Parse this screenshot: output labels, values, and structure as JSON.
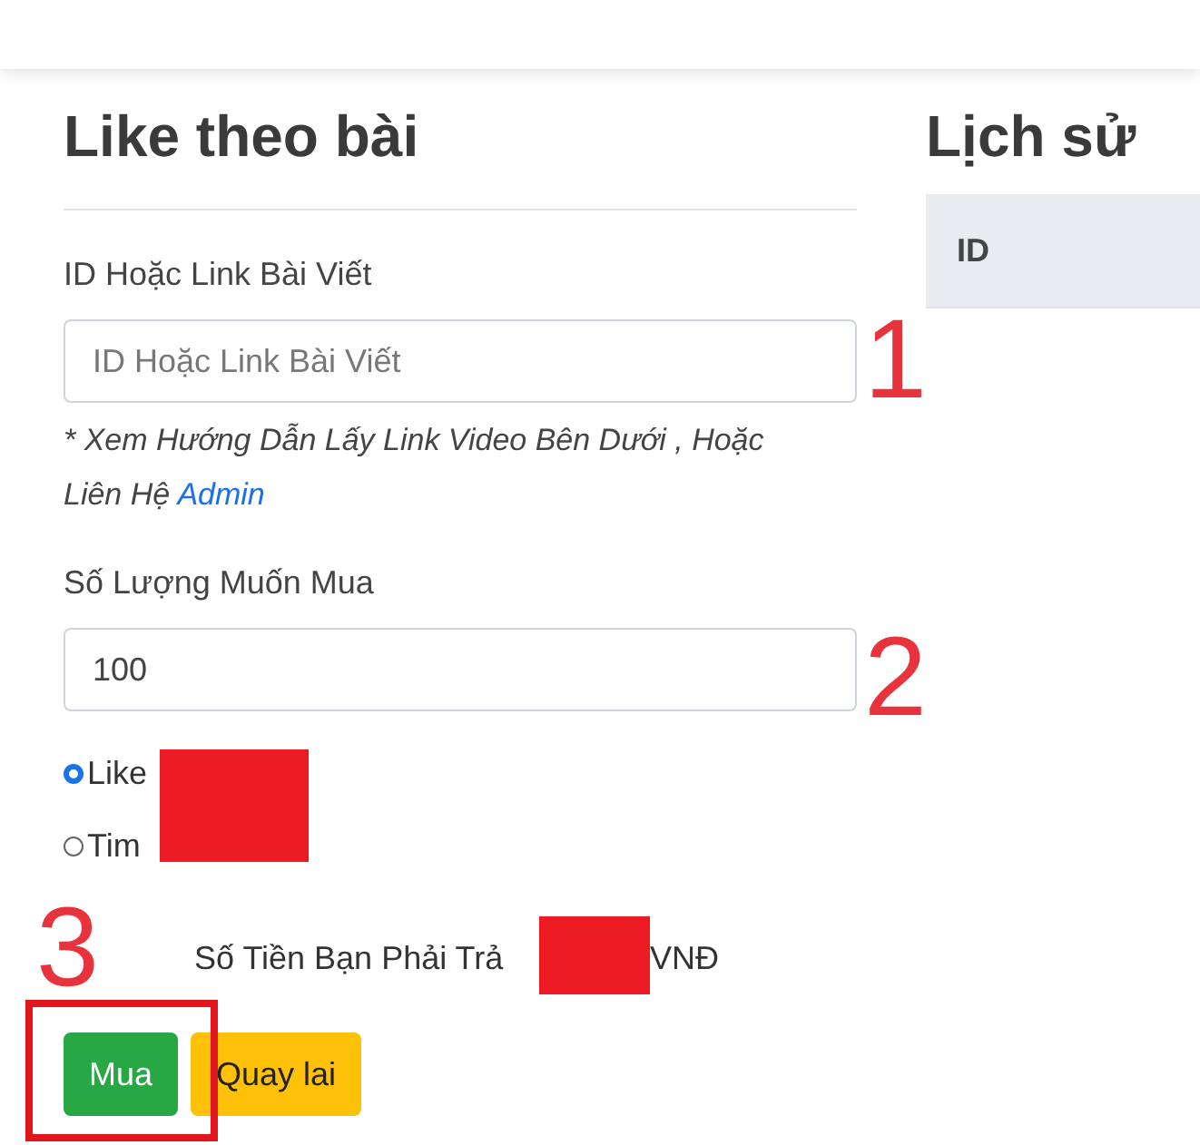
{
  "form": {
    "title": "Like theo bài",
    "link_field": {
      "label": "ID Hoặc Link Bài Viết",
      "placeholder": "ID Hoặc Link Bài Viết"
    },
    "help": {
      "text": "* Xem Hướng Dẫn Lấy Link Video Bên Dưới , Hoặc Liên Hệ",
      "link": "Admin"
    },
    "quantity_field": {
      "label": "Số Lượng Muốn Mua",
      "value": "100"
    },
    "options": [
      {
        "label": "Like",
        "selected": true
      },
      {
        "label": "Tim",
        "selected": false
      }
    ],
    "price": {
      "label": "Số Tiền Bạn Phải Trả",
      "unit": "VNĐ"
    },
    "buttons": [
      {
        "label": "Mua",
        "kind": "primary"
      },
      {
        "label": "Quay lai",
        "kind": "warning"
      }
    ]
  },
  "history": {
    "title": "Lịch sử",
    "columns": [
      "ID"
    ]
  },
  "annotations": [
    "1",
    "2",
    "3"
  ]
}
